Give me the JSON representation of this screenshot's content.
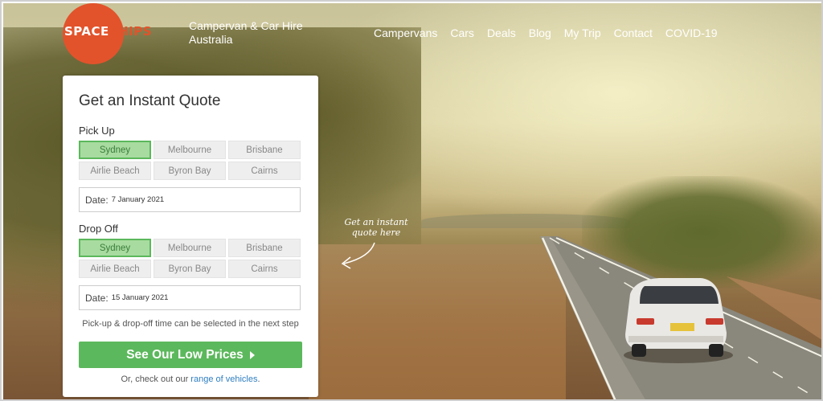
{
  "brand": {
    "logo_part1": "SPACE",
    "logo_part2": "SHIPS",
    "tagline": "Campervan & Car Hire Australia",
    "accent_color": "#e2532b"
  },
  "nav": {
    "items": [
      "Campervans",
      "Cars",
      "Deals",
      "Blog",
      "My Trip",
      "Contact",
      "COVID-19"
    ]
  },
  "quote": {
    "title": "Get an Instant Quote",
    "pickup_label": "Pick Up",
    "pickup_cities": [
      "Sydney",
      "Melbourne",
      "Brisbane",
      "Airlie Beach",
      "Byron Bay",
      "Cairns"
    ],
    "pickup_selected": "Sydney",
    "pickup_date_label": "Date:",
    "pickup_date_value": "7 January 2021",
    "dropoff_label": "Drop Off",
    "dropoff_cities": [
      "Sydney",
      "Melbourne",
      "Brisbane",
      "Airlie Beach",
      "Byron Bay",
      "Cairns"
    ],
    "dropoff_selected": "Sydney",
    "dropoff_date_label": "Date:",
    "dropoff_date_value": "15 January 2021",
    "note": "Pick-up & drop-off time can be selected in the next step",
    "cta_label": "See Our Low Prices",
    "footer_prefix": "Or, check out our",
    "footer_link": "range of vehicles",
    "footer_suffix": ".",
    "cta_color": "#5cb85c"
  },
  "callout": {
    "line1": "Get an instant",
    "line2": "quote here"
  }
}
